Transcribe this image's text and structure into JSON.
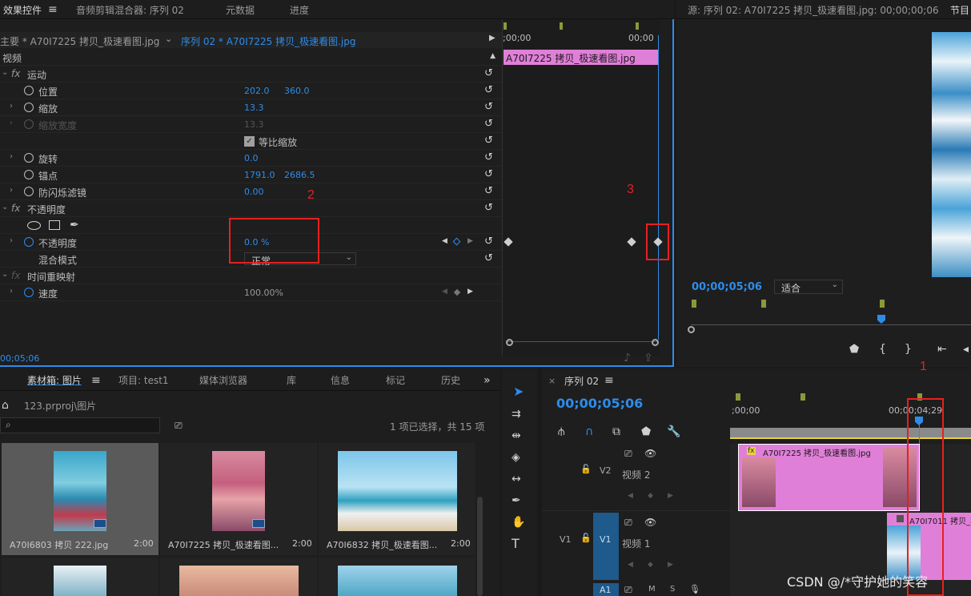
{
  "effect_panel": {
    "tabs": [
      "效果控件",
      "音频剪辑混合器: 序列 02",
      "元数据",
      "进度"
    ],
    "source_label": "主要 * A70I7225 拷贝_极速看图.jpg",
    "seq_label": "序列 02 * A70I7225 拷贝_极速看图.jpg",
    "ruler_start": ";00;00",
    "ruler_end": "00;00",
    "clip_name": "A70I7225 拷贝_极速看图.jpg",
    "video_header": "视频",
    "motion": "运动",
    "position_label": "位置",
    "position_x": "202.0",
    "position_y": "360.0",
    "scale_label": "缩放",
    "scale_value": "13.3",
    "scale_width_label": "缩放宽度",
    "scale_width_value": "13.3",
    "uniform_scale_label": "等比缩放",
    "rotation_label": "旋转",
    "rotation_value": "0.0",
    "anchor_label": "锚点",
    "anchor_x": "1791.0",
    "anchor_y": "2686.5",
    "flicker_label": "防闪烁滤镜",
    "flicker_value": "0.00",
    "opacity_group": "不透明度",
    "opacity_label": "不透明度",
    "opacity_value": "0.0 %",
    "blend_label": "混合模式",
    "blend_value": "正常",
    "time_remap": "时间重映射",
    "speed_label": "速度",
    "speed_value": "100.00%",
    "timecode": "00;05;06",
    "anno2": "2",
    "anno3": "3"
  },
  "program_monitor": {
    "source_title": "源: 序列 02: A70I7225 拷贝_极速看图.jpg: 00;00;00;06",
    "program_tab": "节目",
    "timecode": "00;00;05;06",
    "fit_label": "适合"
  },
  "bin_panel": {
    "tabs": [
      "素材箱: 图片",
      "项目: test1",
      "媒体浏览器",
      "库",
      "信息",
      "标记",
      "历史"
    ],
    "path": "123.prproj\\图片",
    "selection_info": "1 项已选择，共 15 项",
    "items": [
      {
        "name": "A70I6803 拷贝 222.jpg",
        "duration": "2:00"
      },
      {
        "name": "A70I7225 拷贝_极速看图...",
        "duration": "2:00"
      },
      {
        "name": "A70I6832 拷贝_极速看图...",
        "duration": "2:00"
      }
    ]
  },
  "timeline": {
    "title": "序列 02",
    "timecode": "00;00;05;06",
    "ruler_start": ";00;00",
    "ruler_mark": "00;00;04;29",
    "v2_label": "V2",
    "v2_name": "视频 2",
    "v1_label": "V1",
    "v1_name": "视频 1",
    "a1_label": "A1",
    "clip_top": "A70I7225 拷贝_极速看图.jpg",
    "clip_bottom": "A70I7011 拷贝_极",
    "anno1": "1"
  },
  "watermark": "CSDN @/*守护她的笑容",
  "colors": {
    "accent_blue": "#2d8ceb",
    "clip_pink": "#e07fd8",
    "annotation_red": "#e82020",
    "track_blue": "#1e5a8c"
  }
}
